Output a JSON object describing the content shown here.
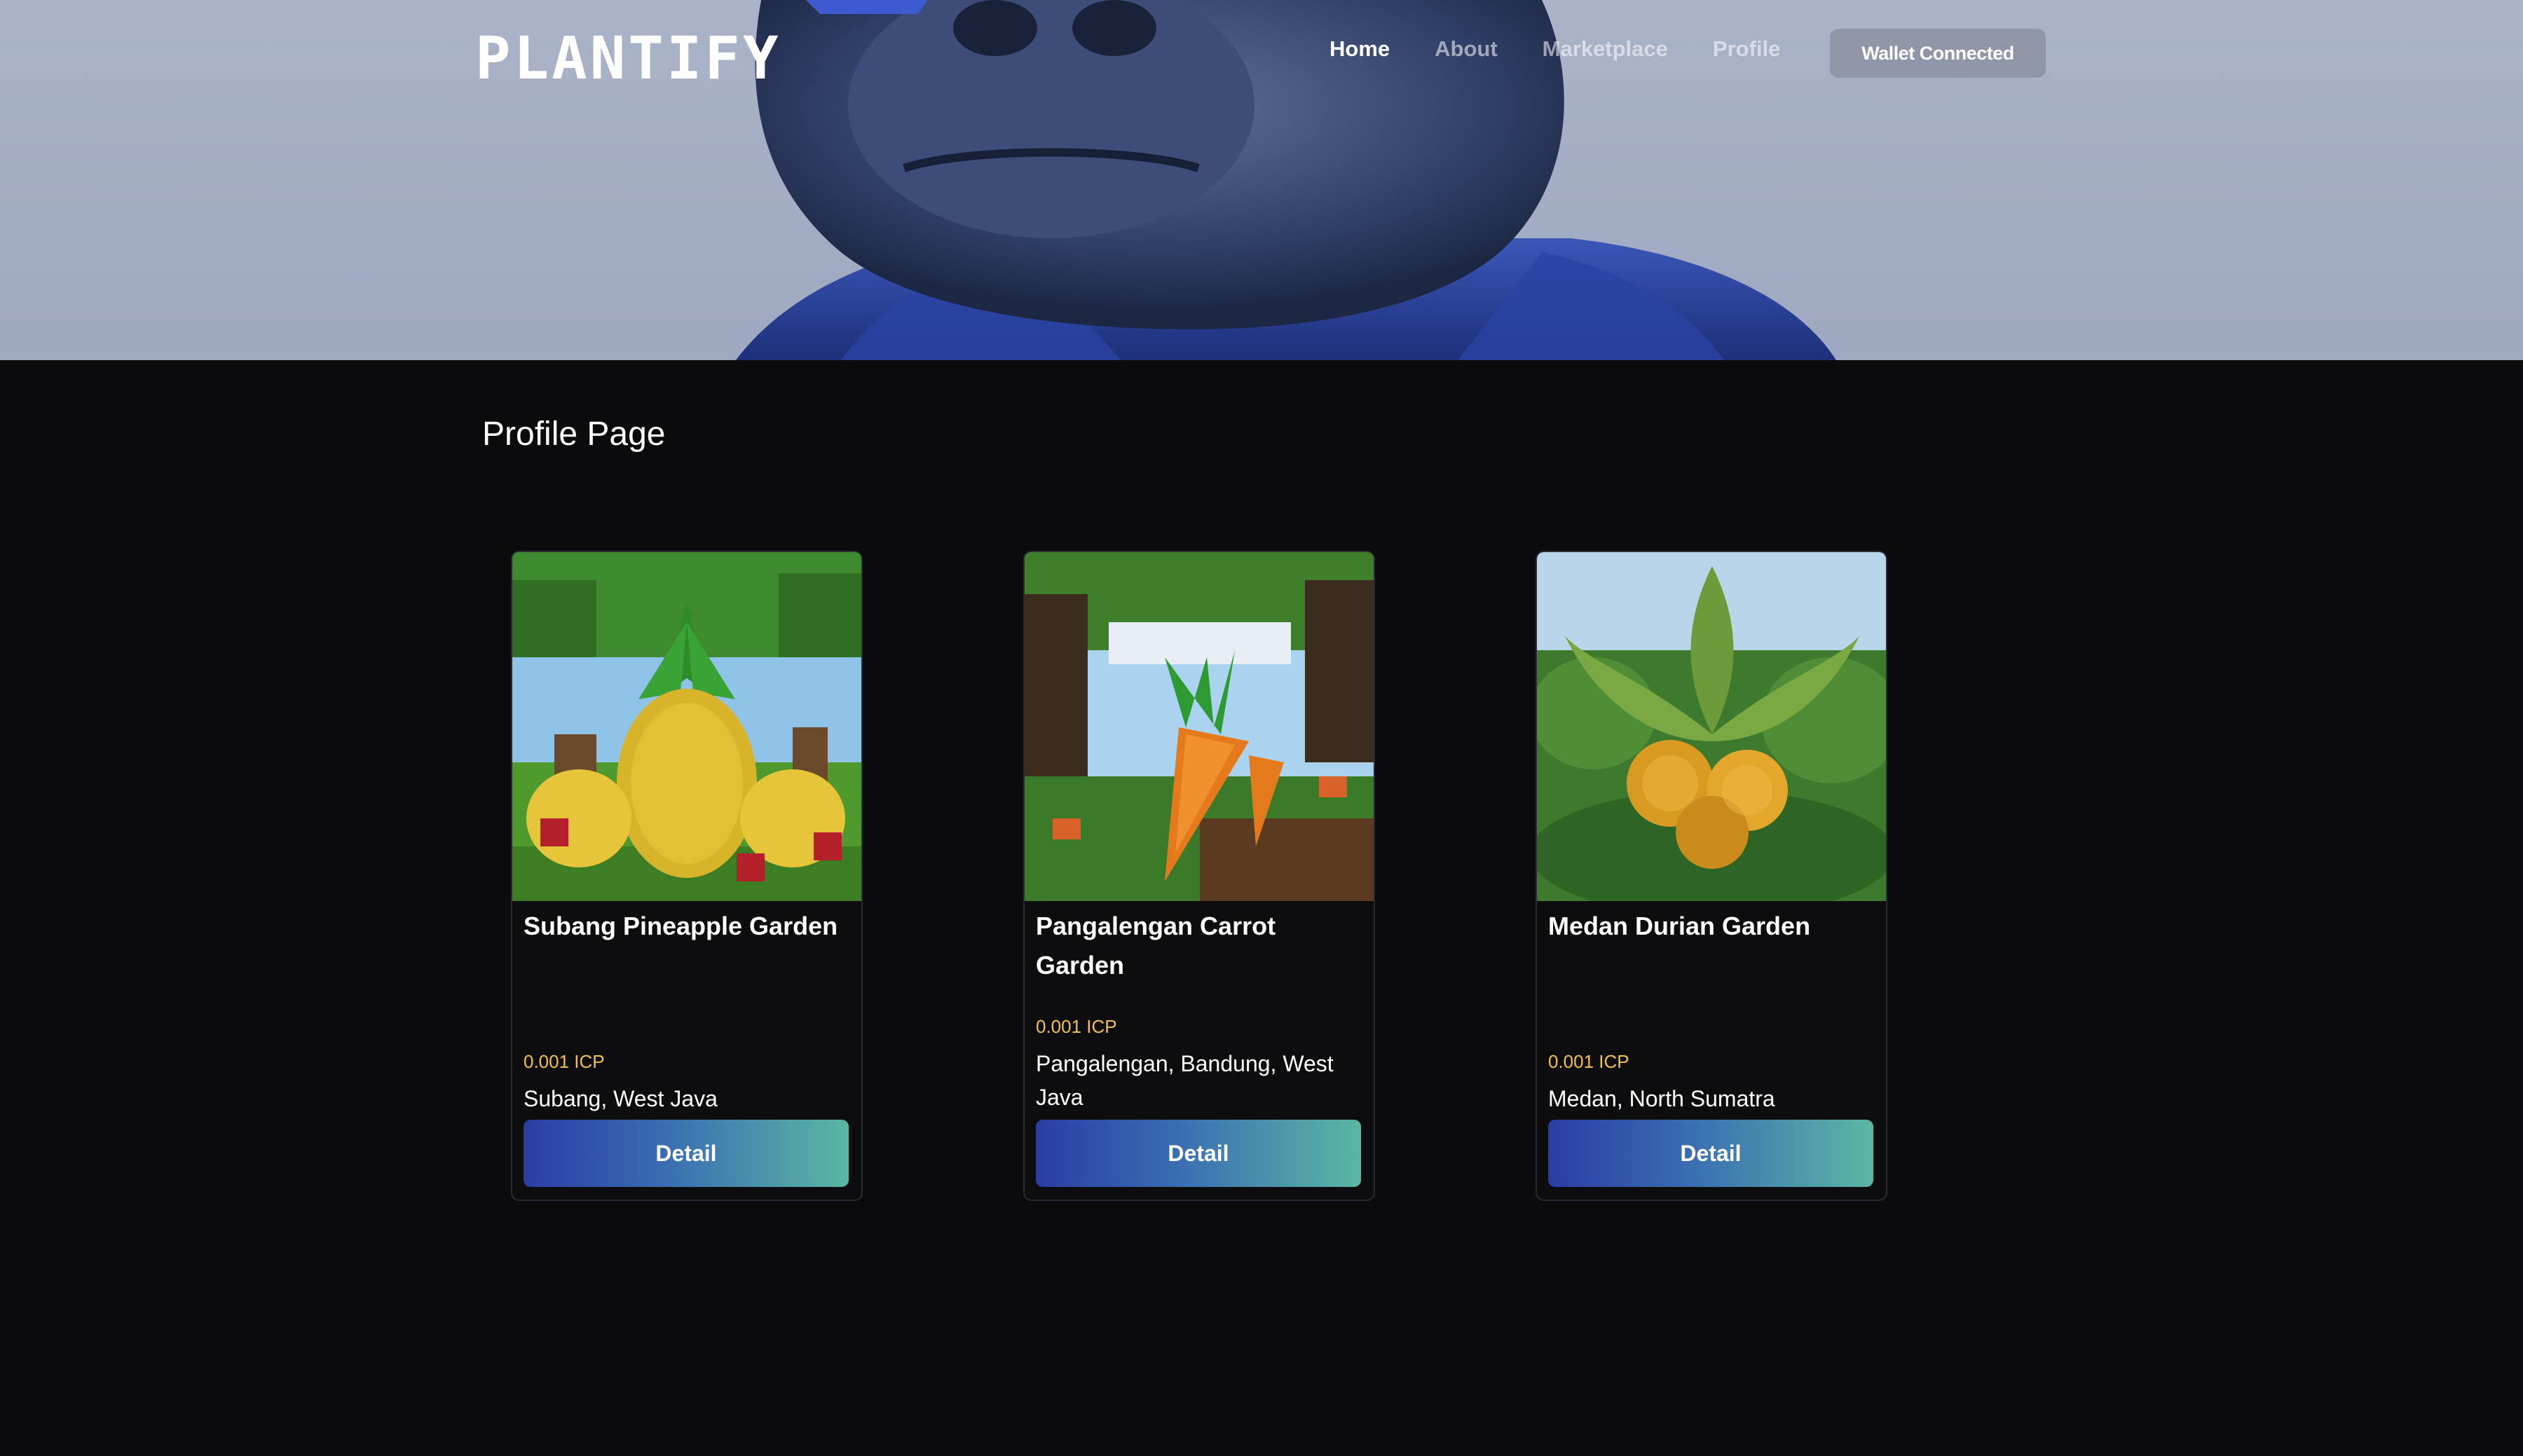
{
  "header": {
    "logo": "PLANTIFY",
    "nav": [
      "Home",
      "About",
      "Marketplace",
      "Profile"
    ],
    "wallet_label": "Wallet Connected"
  },
  "page": {
    "title": "Profile Page"
  },
  "cards": [
    {
      "name": "Subang Pineapple Garden",
      "price": "0.001 ICP",
      "location": "Subang, West Java",
      "button": "Detail",
      "image_icon": "pineapple-image"
    },
    {
      "name": "Pangalengan Carrot Garden",
      "price": "0.001 ICP",
      "location": "Pangalengan, Bandung, West Java",
      "button": "Detail",
      "image_icon": "carrot-image"
    },
    {
      "name": "Medan Durian Garden",
      "price": "0.001 ICP",
      "location": "Medan, North Sumatra",
      "button": "Detail",
      "image_icon": "durian-image"
    }
  ],
  "colors": {
    "background": "#0b0b0d",
    "hero": "#9ea8bf",
    "price": "#f2c14b",
    "button_start": "#2a3da4",
    "button_end": "#5bb7a4"
  }
}
